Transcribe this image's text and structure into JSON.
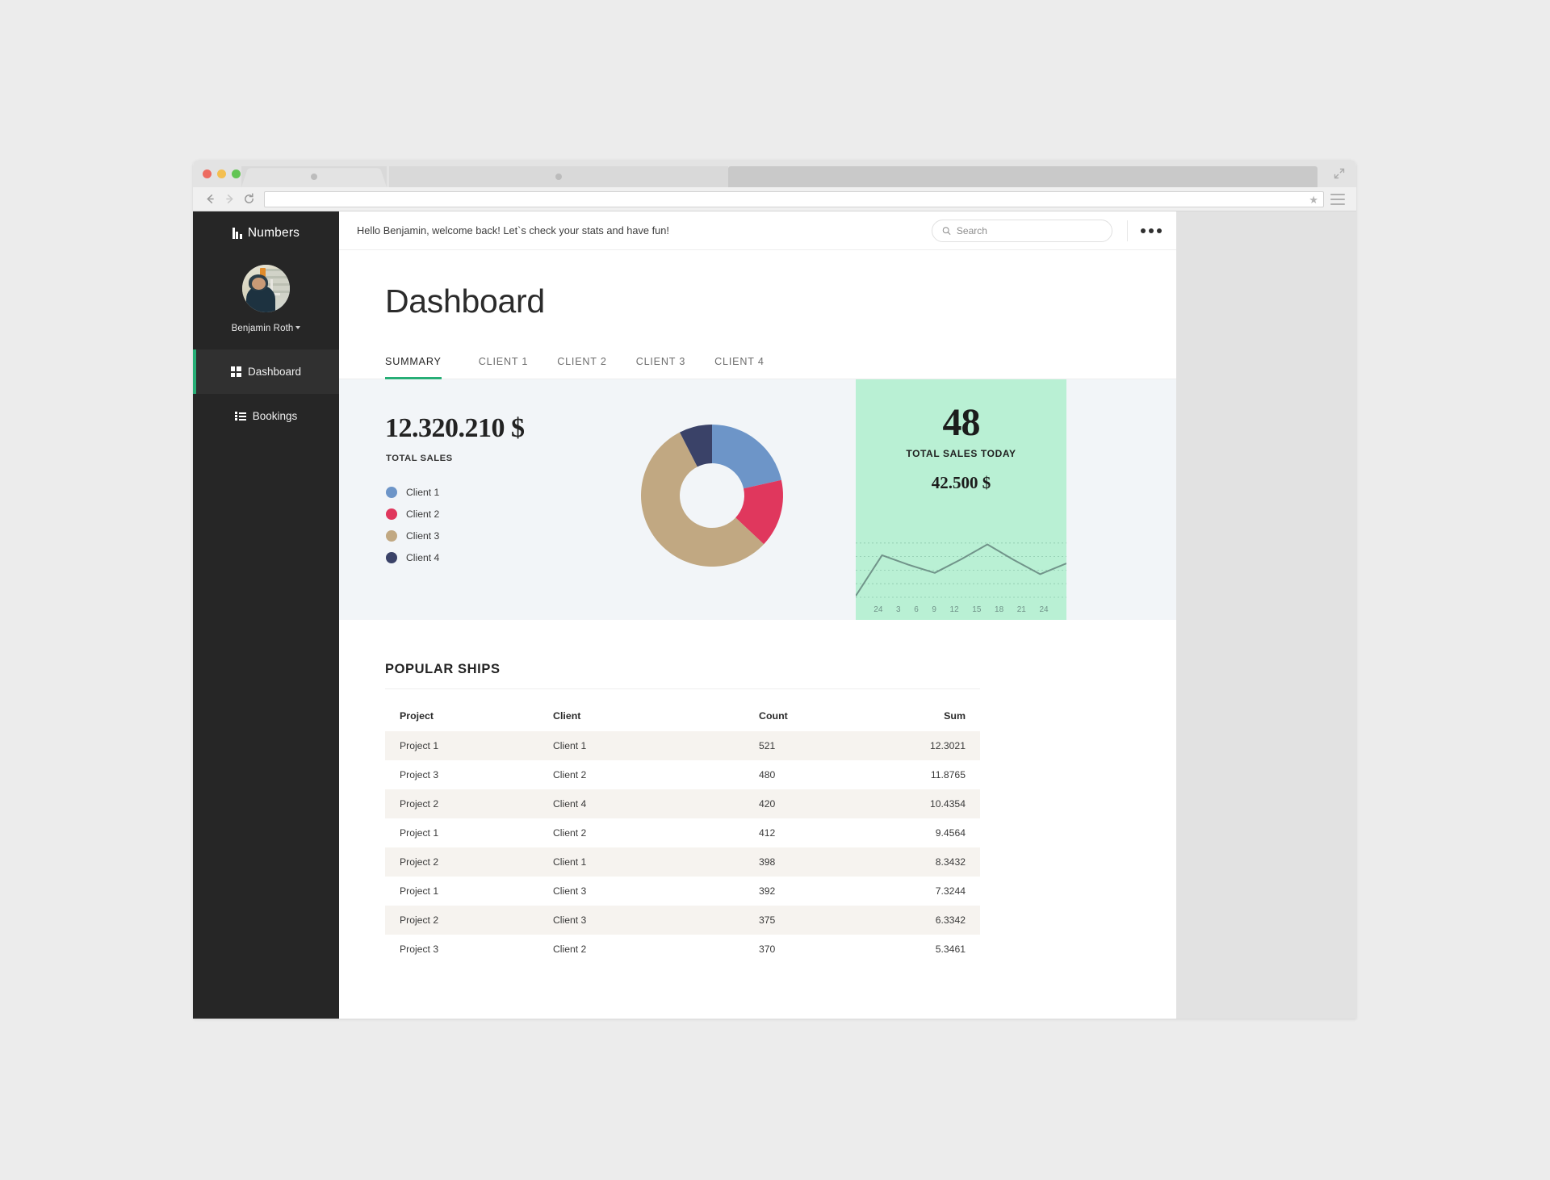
{
  "browser": {
    "tabs": [
      "",
      ""
    ],
    "address_value": "",
    "back_icon": "back-arrow-icon",
    "forward_icon": "forward-arrow-icon",
    "reload_icon": "reload-icon",
    "bookmark_icon": "star-icon",
    "menu_icon": "hamburger-menu-icon",
    "expand_icon": "expand-icon"
  },
  "sidebar": {
    "brand": "Numbers",
    "profile_name": "Benjamin Roth",
    "items": [
      {
        "label": "Dashboard",
        "icon": "grid-icon",
        "active": true
      },
      {
        "label": "Bookings",
        "icon": "list-icon",
        "active": false
      }
    ]
  },
  "topbar": {
    "greeting": "Hello Benjamin, welcome back! Let`s check your stats and have fun!",
    "search_placeholder": "Search",
    "search_value": "",
    "more_label": "..."
  },
  "page": {
    "title": "Dashboard",
    "tabs": [
      {
        "label": "SUMMARY",
        "active": true
      },
      {
        "label": "CLIENT 1",
        "active": false
      },
      {
        "label": "CLIENT 2",
        "active": false
      },
      {
        "label": "CLIENT 3",
        "active": false
      },
      {
        "label": "CLIENT 4",
        "active": false
      }
    ]
  },
  "stats": {
    "total_sales_value": "12.320.210 $",
    "total_sales_label": "TOTAL SALES",
    "today_count": "48",
    "today_label": "TOTAL SALES TODAY",
    "today_amount": "42.500 $",
    "card_color": "#b9f0d4",
    "accent_color": "#27ae76"
  },
  "ships": {
    "title": "POPULAR SHIPS",
    "columns": [
      "Project",
      "Client",
      "Count",
      "Sum"
    ],
    "rows": [
      {
        "project": "Project 1",
        "client": "Client 1",
        "count": "521",
        "sum": "12.3021"
      },
      {
        "project": "Project 3",
        "client": "Client 2",
        "count": "480",
        "sum": "11.8765"
      },
      {
        "project": "Project 2",
        "client": "Client 4",
        "count": "420",
        "sum": "10.4354"
      },
      {
        "project": "Project 1",
        "client": "Client 2",
        "count": "412",
        "sum": "9.4564"
      },
      {
        "project": "Project 2",
        "client": "Client 1",
        "count": "398",
        "sum": "8.3432"
      },
      {
        "project": "Project 1",
        "client": "Client 3",
        "count": "392",
        "sum": "7.3244"
      },
      {
        "project": "Project 2",
        "client": "Client 3",
        "count": "375",
        "sum": "6.3342"
      },
      {
        "project": "Project 3",
        "client": "Client 2",
        "count": "370",
        "sum": "5.3461"
      }
    ]
  },
  "chart_data": [
    {
      "type": "pie",
      "title": "Total sales by client",
      "donut": true,
      "labels": [
        "Client 1",
        "Client 2",
        "Client 3",
        "Client 4"
      ],
      "values": [
        21.5,
        15.5,
        55.5,
        7.5
      ],
      "unit": "percent",
      "colors": [
        "#6d95c8",
        "#e0375d",
        "#c1a882",
        "#3a4268"
      ],
      "legend": "left",
      "start_angle_deg": 0
    },
    {
      "type": "line",
      "title": "Sales today by hour",
      "x": [
        "24",
        "3",
        "6",
        "9",
        "12",
        "15",
        "18",
        "21",
        "24"
      ],
      "xlabel": "",
      "ylabel": "",
      "values": [
        2,
        62,
        48,
        36,
        56,
        78,
        55,
        34,
        50
      ],
      "ylim": [
        0,
        100
      ],
      "grid": true,
      "line_color": "#71948a",
      "background": "#b9f0d4"
    }
  ]
}
